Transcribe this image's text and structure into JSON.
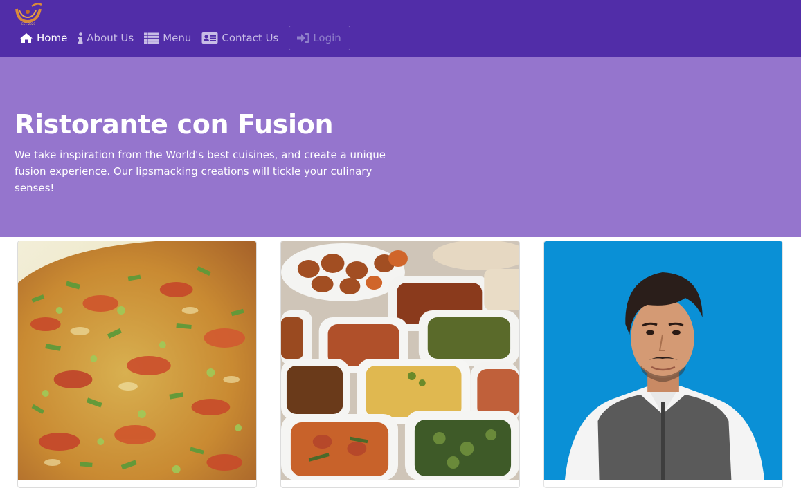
{
  "brand": {
    "logo_icon": "restaurant-logo-icon",
    "logo_text": "EST. 2020"
  },
  "nav": {
    "items": [
      {
        "label": "Home",
        "icon": "home-icon",
        "active": true
      },
      {
        "label": "About Us",
        "icon": "info-icon",
        "active": false
      },
      {
        "label": "Menu",
        "icon": "list-icon",
        "active": false
      },
      {
        "label": "Contact Us",
        "icon": "address-card-icon",
        "active": false
      }
    ],
    "login": {
      "label": "Login",
      "icon": "sign-in-icon"
    }
  },
  "jumbotron": {
    "title": "Ristorante con Fusion",
    "description": "We take inspiration from the World's best cuisines, and create a unique fusion experience. Our lipsmacking creations will tickle your culinary senses!"
  },
  "cards": [
    {
      "image": "pizza-image"
    },
    {
      "image": "buffet-dishes-image"
    },
    {
      "image": "chef-portrait-image"
    }
  ],
  "colors": {
    "navbar": "#512da8",
    "jumbotron": "#9575cd",
    "nav_inactive": "#c8bde6",
    "nav_active": "#ffffff",
    "portrait_background": "#0a90d6"
  }
}
